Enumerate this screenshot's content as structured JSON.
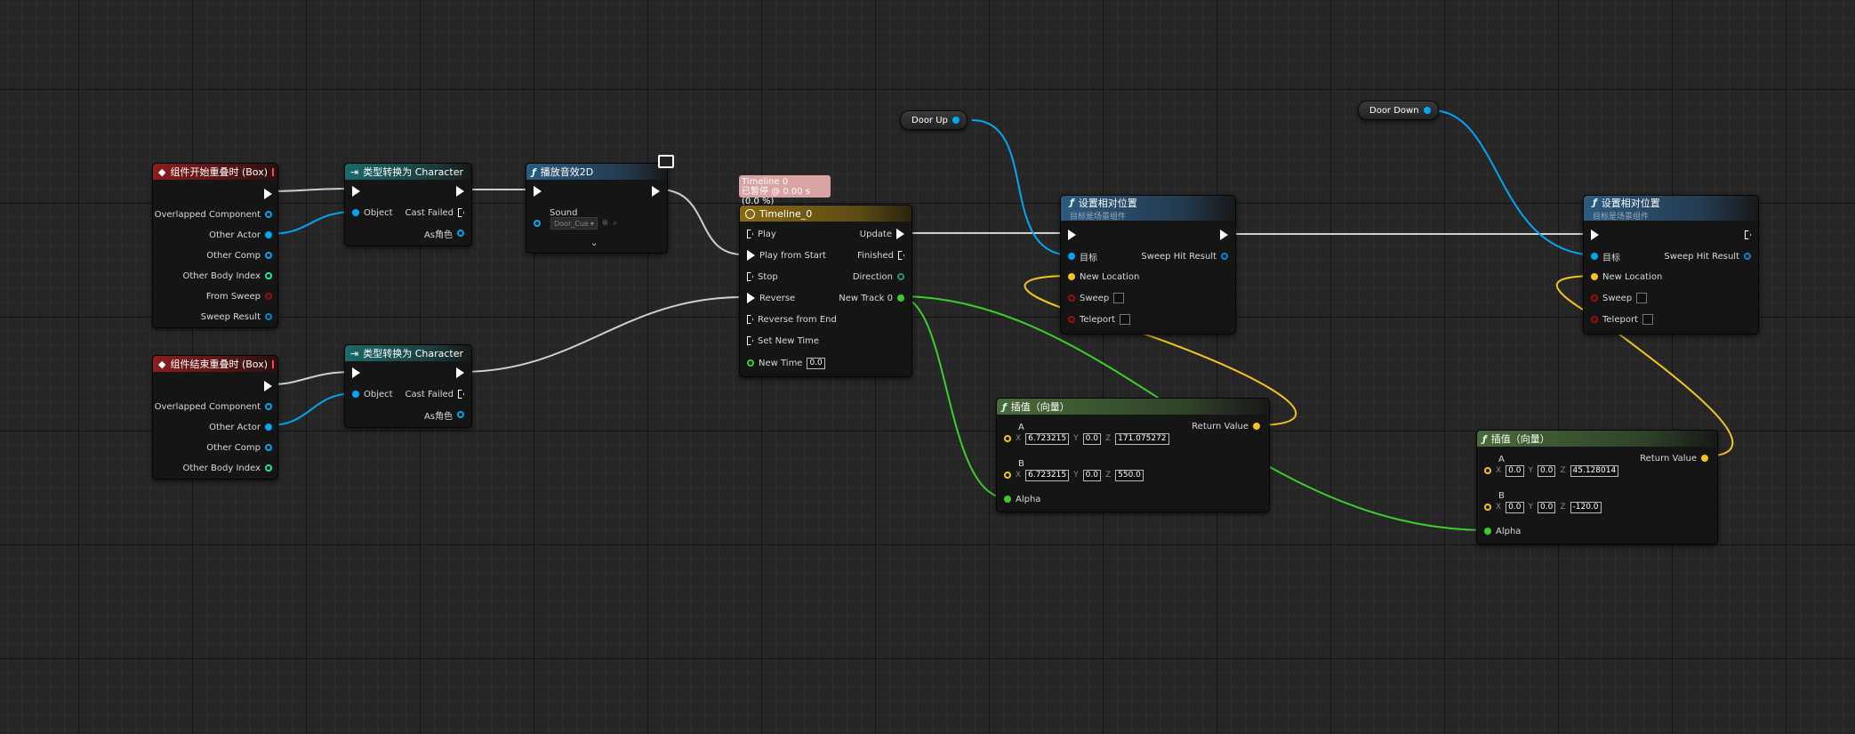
{
  "nodes": {
    "overlap_begin": {
      "title": "组件开始重叠时 (Box)",
      "pins": [
        "Overlapped Component",
        "Other Actor",
        "Other Comp",
        "Other Body Index",
        "From Sweep",
        "Sweep Result"
      ]
    },
    "overlap_end": {
      "title": "组件结束重叠时 (Box)",
      "pins": [
        "Overlapped Component",
        "Other Actor",
        "Other Comp",
        "Other Body Index"
      ]
    },
    "cast1": {
      "title": "类型转换为 Character",
      "object": "Object",
      "cast_failed": "Cast Failed",
      "as": "As角色"
    },
    "cast2": {
      "title": "类型转换为 Character",
      "object": "Object",
      "cast_failed": "Cast Failed",
      "as": "As角色"
    },
    "play_sound": {
      "title": "播放音效2D",
      "sound_label": "Sound",
      "sound_value": "Door_Cue"
    },
    "timeline": {
      "comment_line1": "Timeline 0",
      "comment_line2": "已暂停 @ 0.00 s (0.0 %)",
      "title": "Timeline_0",
      "inputs": [
        "Play",
        "Play from Start",
        "Stop",
        "Reverse",
        "Reverse from End",
        "Set New Time",
        "New Time"
      ],
      "new_time_value": "0.0",
      "outputs": [
        "Update",
        "Finished",
        "Direction",
        "New Track 0"
      ]
    },
    "door_up": {
      "label": "Door Up"
    },
    "door_down": {
      "label": "Door Down"
    },
    "set_loc1": {
      "title": "设置相对位置",
      "subtitle": "目标是场景组件",
      "target": "目标",
      "sweep_hit": "Sweep Hit Result",
      "new_location": "New Location",
      "sweep": "Sweep",
      "teleport": "Teleport"
    },
    "set_loc2": {
      "title": "设置相对位置",
      "subtitle": "目标是场景组件",
      "target": "目标",
      "sweep_hit": "Sweep Hit Result",
      "new_location": "New Location",
      "sweep": "Sweep",
      "teleport": "Teleport"
    },
    "lerp1": {
      "title": "插值（向量）",
      "a": "A",
      "b": "B",
      "alpha": "Alpha",
      "ret": "Return Value",
      "ax": "6.723215",
      "ay": "0.0",
      "az": "171.075272",
      "bx": "6.723215",
      "by": "0.0",
      "bz": "550.0"
    },
    "lerp2": {
      "title": "插值（向量）",
      "a": "A",
      "b": "B",
      "alpha": "Alpha",
      "ret": "Return Value",
      "ax": "0.0",
      "ay": "0.0",
      "az": "45.128014",
      "bx": "0.0",
      "by": "0.0",
      "bz": "-120.0"
    }
  },
  "axes": {
    "x": "X",
    "y": "Y",
    "z": "Z"
  },
  "colors": {
    "exec": "#ffffff",
    "object": "#00a8f4",
    "struct": "#0088d8",
    "int": "#1fe3af",
    "bool": "#9d0d0d",
    "float": "#3ccf2c",
    "vector": "#f6c31c",
    "wire_exec": "#d0d0d0"
  }
}
